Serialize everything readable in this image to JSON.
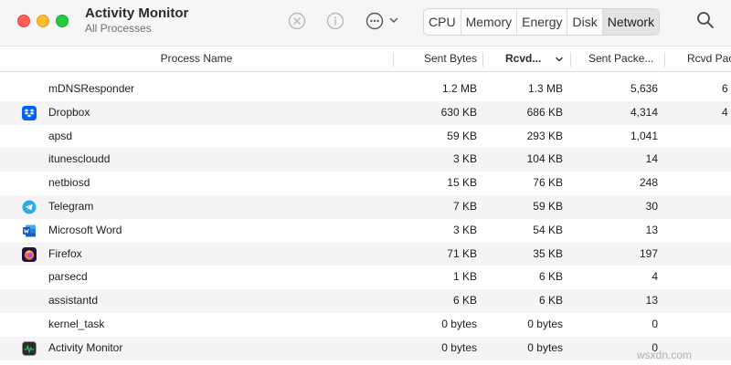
{
  "window": {
    "title": "Activity Monitor",
    "subtitle": "All Processes"
  },
  "toolbar": {
    "icons": [
      "stop-process-icon",
      "info-icon",
      "more-actions-icon",
      "chevron-down-icon",
      "search-icon"
    ],
    "tabs": [
      {
        "label": "CPU",
        "active": false
      },
      {
        "label": "Memory",
        "active": false
      },
      {
        "label": "Energy",
        "active": false
      },
      {
        "label": "Disk",
        "active": false
      },
      {
        "label": "Network",
        "active": true
      }
    ]
  },
  "table": {
    "columns": {
      "process_name": "Process Name",
      "sent_bytes": "Sent Bytes",
      "rcvd_bytes": "Rcvd...",
      "sent_packets": "Sent Packe...",
      "rcvd_packets": "Rcvd Pac"
    },
    "sorted_column": "rcvd_bytes",
    "rows": [
      {
        "name": "mDNSResponder",
        "sent": "1.2 MB",
        "rcvd": "1.3 MB",
        "sent_packets": "5,636",
        "rcvd_packets": "6",
        "icon": ""
      },
      {
        "name": "Dropbox",
        "sent": "630 KB",
        "rcvd": "686 KB",
        "sent_packets": "4,314",
        "rcvd_packets": "4",
        "icon": "dropbox-icon"
      },
      {
        "name": "apsd",
        "sent": "59 KB",
        "rcvd": "293 KB",
        "sent_packets": "1,041",
        "rcvd_packets": "",
        "icon": ""
      },
      {
        "name": "itunescloudd",
        "sent": "3 KB",
        "rcvd": "104 KB",
        "sent_packets": "14",
        "rcvd_packets": "",
        "icon": ""
      },
      {
        "name": "netbiosd",
        "sent": "15 KB",
        "rcvd": "76 KB",
        "sent_packets": "248",
        "rcvd_packets": "",
        "icon": ""
      },
      {
        "name": "Telegram",
        "sent": "7 KB",
        "rcvd": "59 KB",
        "sent_packets": "30",
        "rcvd_packets": "",
        "icon": "telegram-icon"
      },
      {
        "name": "Microsoft Word",
        "sent": "3 KB",
        "rcvd": "54 KB",
        "sent_packets": "13",
        "rcvd_packets": "",
        "icon": "word-icon"
      },
      {
        "name": "Firefox",
        "sent": "71 KB",
        "rcvd": "35 KB",
        "sent_packets": "197",
        "rcvd_packets": "",
        "icon": "firefox-icon"
      },
      {
        "name": "parsecd",
        "sent": "1 KB",
        "rcvd": "6 KB",
        "sent_packets": "4",
        "rcvd_packets": "",
        "icon": ""
      },
      {
        "name": "assistantd",
        "sent": "6 KB",
        "rcvd": "6 KB",
        "sent_packets": "13",
        "rcvd_packets": "",
        "icon": ""
      },
      {
        "name": "kernel_task",
        "sent": "0 bytes",
        "rcvd": "0 bytes",
        "sent_packets": "0",
        "rcvd_packets": "",
        "icon": ""
      },
      {
        "name": "Activity Monitor",
        "sent": "0 bytes",
        "rcvd": "0 bytes",
        "sent_packets": "0",
        "rcvd_packets": "",
        "icon": "activity-monitor-icon"
      }
    ]
  },
  "watermark": "wsxdn.com",
  "colors": {
    "close": "#fe5f57",
    "minimize": "#febc2e",
    "zoom": "#28c840",
    "row_alt": "#f4f4f6",
    "dropbox": "#0061fe",
    "telegram": "#2aabee",
    "word": "#185abd"
  }
}
